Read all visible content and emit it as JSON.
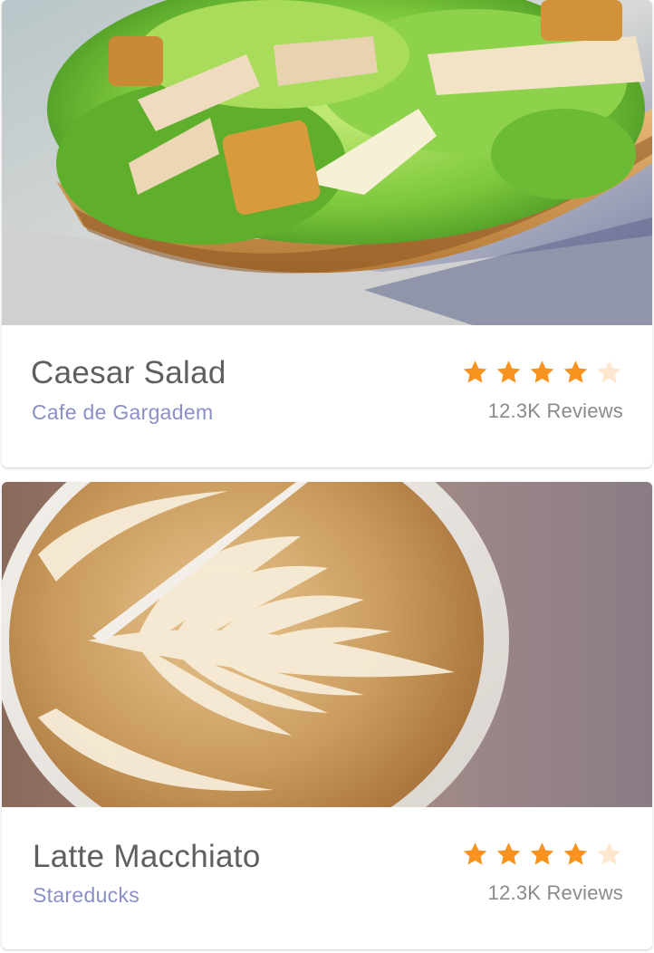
{
  "cards": [
    {
      "title": "Caesar Salad",
      "place": "Cafe de Gargadem",
      "rating": 4,
      "max_rating": 5,
      "reviews": "12.3K Reviews",
      "image_icon": "caesar-salad-photo"
    },
    {
      "title": "Latte Macchiato",
      "place": "Stareducks",
      "rating": 4,
      "max_rating": 5,
      "reviews": "12.3K Reviews",
      "image_icon": "latte-art-photo"
    }
  ],
  "colors": {
    "title": "#5f5f5f",
    "place": "#8a90c7",
    "star_filled": "#f7931e",
    "star_empty": "#fde7cf",
    "reviews": "#8a8a8a"
  }
}
